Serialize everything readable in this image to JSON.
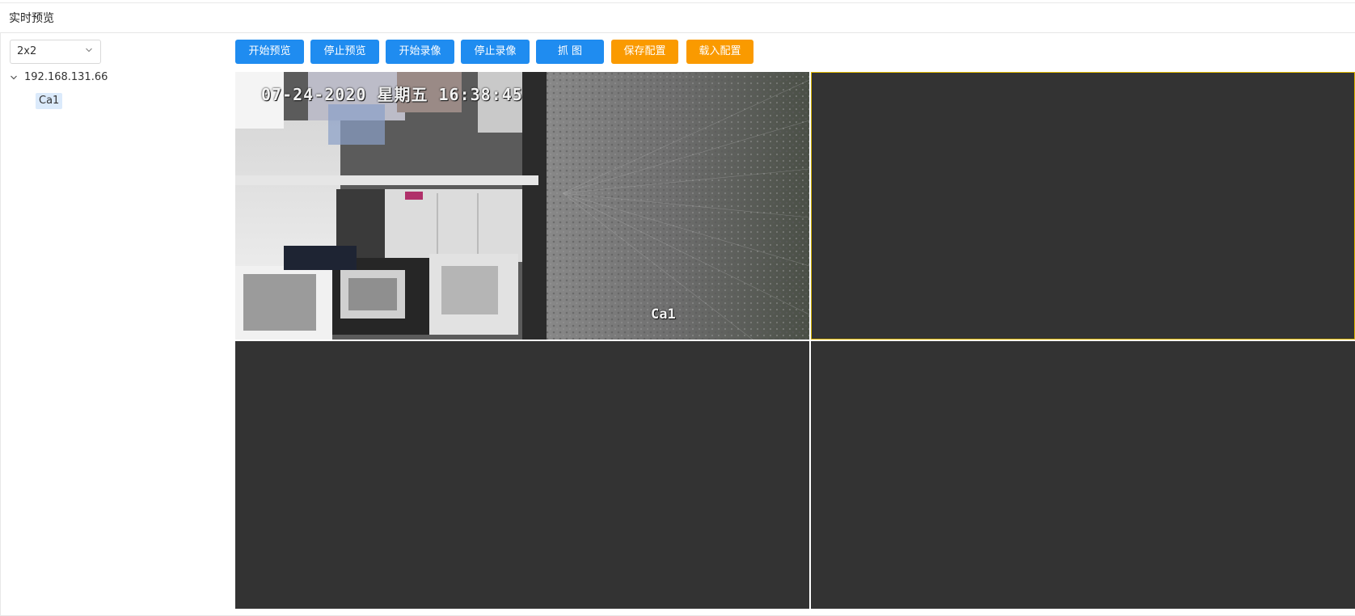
{
  "page": {
    "title": "实时预览"
  },
  "sidebar": {
    "layout_select": {
      "value": "2x2",
      "icon": "chevron-down-icon"
    },
    "tree": {
      "device": {
        "label": "192.168.131.66",
        "expanded": true,
        "icon": "chevron-down-icon"
      },
      "channels": [
        {
          "label": "Ca1",
          "selected": true
        }
      ]
    }
  },
  "toolbar": {
    "start_preview": "开始预览",
    "stop_preview": "停止预览",
    "start_record": "开始录像",
    "stop_record": "停止录像",
    "capture": "抓 图",
    "save_config": "保存配置",
    "load_config": "载入配置"
  },
  "colors": {
    "primary_button": "#1f8cf0",
    "secondary_button": "#fa9a00",
    "empty_cell": "#333333",
    "active_cell_border": "#e0b800",
    "tree_selected_bg": "#dbeafb"
  },
  "video_grid": {
    "layout": "2x2",
    "cells": [
      {
        "active": false,
        "playing": true,
        "osd_datetime": "07-24-2020 星期五 16:38:45",
        "osd_channel": "Ca1"
      },
      {
        "active": true,
        "playing": false
      },
      {
        "active": false,
        "playing": false
      },
      {
        "active": false,
        "playing": false
      }
    ]
  }
}
